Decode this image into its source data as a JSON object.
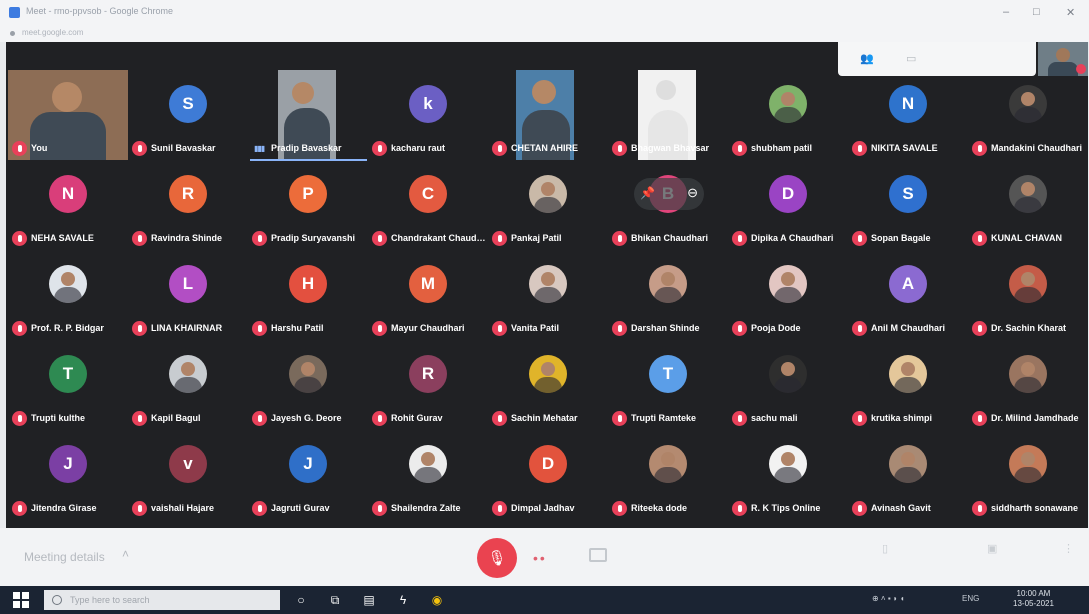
{
  "window": {
    "title": "Meet - rmo-ppvsob - Google Chrome",
    "url": "meet.google.com"
  },
  "participants": [
    {
      "name": "You",
      "kind": "video",
      "bg": "#8d6d55"
    },
    {
      "name": "Sunil Bavaskar",
      "kind": "letter",
      "letter": "S",
      "color": "#3e7bd6"
    },
    {
      "name": "Pradip Bavaskar",
      "kind": "video",
      "bg": "#9aa0a6",
      "speaking": true
    },
    {
      "name": "kacharu raut",
      "kind": "letter",
      "letter": "k",
      "color": "#6b5fc4"
    },
    {
      "name": "CHETAN AHIRE",
      "kind": "video",
      "bg": "#4d7fa8"
    },
    {
      "name": "Bhagwan Bhavsar",
      "kind": "video",
      "bg": "#f1f1f1"
    },
    {
      "name": "shubham patil",
      "kind": "photo",
      "color": "#7fb26a"
    },
    {
      "name": "NIKITA SAVALE",
      "kind": "letter",
      "letter": "N",
      "color": "#2e73cc"
    },
    {
      "name": "Mandakini Chaudhari",
      "kind": "photo",
      "color": "#3a3a3a"
    },
    {
      "name": "NEHA SAVALE",
      "kind": "letter",
      "letter": "N",
      "color": "#d93e7a"
    },
    {
      "name": "Ravindra Shinde",
      "kind": "letter",
      "letter": "R",
      "color": "#e8673a"
    },
    {
      "name": "Pradip Suryavanshi",
      "kind": "letter",
      "letter": "P",
      "color": "#ec6c3a"
    },
    {
      "name": "Chandrakant Chaudhari",
      "kind": "letter",
      "letter": "C",
      "color": "#e35a40"
    },
    {
      "name": "Pankaj Patil",
      "kind": "photo",
      "color": "#c9b9a8"
    },
    {
      "name": "Bhikan Chaudhari",
      "kind": "letter",
      "letter": "B",
      "color": "#e0457b",
      "hover": true
    },
    {
      "name": "Dipika A Chaudhari",
      "kind": "letter",
      "letter": "D",
      "color": "#9a44c4"
    },
    {
      "name": "Sopan Bagale",
      "kind": "letter",
      "letter": "S",
      "color": "#2f70cf"
    },
    {
      "name": "KUNAL CHAVAN",
      "kind": "photo",
      "color": "#555555"
    },
    {
      "name": "Prof. R. P. Bidgar",
      "kind": "photo",
      "color": "#dfe4ea"
    },
    {
      "name": "LINA KHAIRNAR",
      "kind": "letter",
      "letter": "L",
      "color": "#b24ec4"
    },
    {
      "name": "Harshu Patil",
      "kind": "letter",
      "letter": "H",
      "color": "#e3503f"
    },
    {
      "name": "Mayur Chaudhari",
      "kind": "letter",
      "letter": "M",
      "color": "#e3603f"
    },
    {
      "name": "Vanita Patil",
      "kind": "photo",
      "color": "#d8c8c0"
    },
    {
      "name": "Darshan Shinde",
      "kind": "photo",
      "color": "#c69c88"
    },
    {
      "name": "Pooja Dode",
      "kind": "photo",
      "color": "#e2c6c2"
    },
    {
      "name": "Anil M Chaudhari",
      "kind": "letter",
      "letter": "A",
      "color": "#8b6ad1"
    },
    {
      "name": "Dr. Sachin Kharat",
      "kind": "photo",
      "color": "#c45c48"
    },
    {
      "name": "Trupti kulthe",
      "kind": "letter",
      "letter": "T",
      "color": "#2e8a52"
    },
    {
      "name": "Kapil Bagul",
      "kind": "photo",
      "color": "#c8ccd0"
    },
    {
      "name": "Jayesh G. Deore",
      "kind": "photo",
      "color": "#7a6a5c"
    },
    {
      "name": "Rohit Gurav",
      "kind": "letter",
      "letter": "R",
      "color": "#8b3f5e"
    },
    {
      "name": "Sachin Mehatar",
      "kind": "photo",
      "color": "#e0b42a"
    },
    {
      "name": "Trupti Ramteke",
      "kind": "letter",
      "letter": "T",
      "color": "#5b9ee8"
    },
    {
      "name": "sachu mali",
      "kind": "photo",
      "color": "#2e2e2e"
    },
    {
      "name": "krutika shimpi",
      "kind": "photo",
      "color": "#e4c79a"
    },
    {
      "name": "Dr. Milind Jamdhade",
      "kind": "photo",
      "color": "#9a7560"
    },
    {
      "name": "Jitendra Girase",
      "kind": "letter",
      "letter": "J",
      "color": "#7b3fa4"
    },
    {
      "name": "vaishali Hajare",
      "kind": "letter",
      "letter": "v",
      "color": "#8e3a4a"
    },
    {
      "name": "Jagruti Gurav",
      "kind": "letter",
      "letter": "J",
      "color": "#2f6fc8"
    },
    {
      "name": "Shailendra Zalte",
      "kind": "photo",
      "color": "#ececec"
    },
    {
      "name": "Dimpal Jadhav",
      "kind": "letter",
      "letter": "D",
      "color": "#e2533d"
    },
    {
      "name": "Riteeka dode",
      "kind": "photo",
      "color": "#b48a70"
    },
    {
      "name": "R. K Tips Online",
      "kind": "photo",
      "color": "#f2f2f2"
    },
    {
      "name": "Avinash Gavit",
      "kind": "photo",
      "color": "#a98a74"
    },
    {
      "name": "siddharth sonawane",
      "kind": "photo",
      "color": "#c47a58"
    }
  ],
  "bottom": {
    "meeting_details": "Meeting details",
    "icons": [
      "mic-off-icon",
      "end-call-icon",
      "camera-icon"
    ]
  },
  "taskbar": {
    "search_placeholder": "Type here to search",
    "time": "10:00 AM",
    "date": "13-05-2021",
    "lang": "ENG"
  },
  "colors": {
    "meeting_bg": "#202124",
    "mute_red": "#e8415a",
    "active_blue": "#8ab4f8"
  }
}
